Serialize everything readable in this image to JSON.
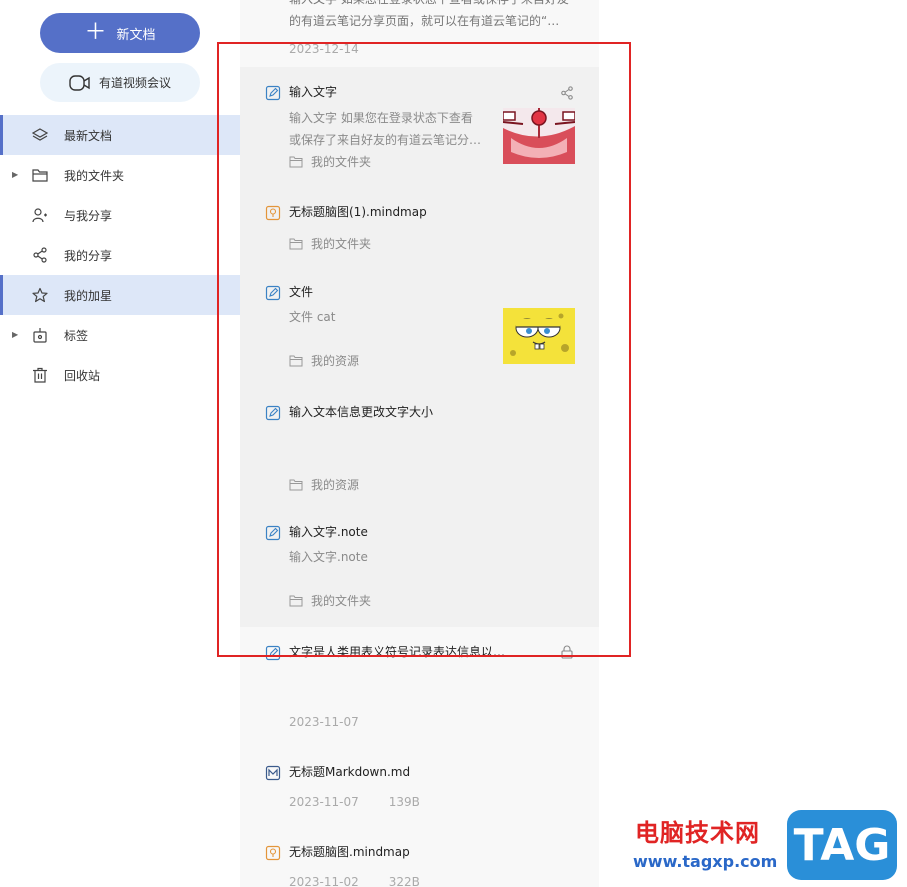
{
  "sidebar": {
    "new_doc": "新文档",
    "video_meeting": "有道视频会议",
    "items": [
      {
        "label": "最新文档",
        "active": true,
        "icon": "layers-icon"
      },
      {
        "label": "我的文件夹",
        "active": false,
        "icon": "folder-icon",
        "expandable": true
      },
      {
        "label": "与我分享",
        "active": false,
        "icon": "users-icon"
      },
      {
        "label": "我的分享",
        "active": false,
        "icon": "share-icon"
      },
      {
        "label": "我的加星",
        "active": true,
        "icon": "star-icon"
      },
      {
        "label": "标签",
        "active": false,
        "icon": "tag-icon",
        "expandable": true
      },
      {
        "label": "回收站",
        "active": false,
        "icon": "trash-icon"
      }
    ]
  },
  "list": {
    "top_partial": {
      "line1": "输入文字 如果您在登录状态下查看或保存了来自好友",
      "line2": "的有道云笔记分享页面，就可以在有道云笔记的“…",
      "date": "2023-12-14"
    },
    "docs": [
      {
        "title": "输入文字",
        "desc1": "输入文字 如果您在登录状态下查看",
        "desc2": "或保存了来自好友的有道云笔记分…",
        "folder": "我的文件夹"
      },
      {
        "title": "无标题脑图(1).mindmap",
        "folder": "我的文件夹"
      },
      {
        "title": "文件",
        "desc1": "文件 cat",
        "folder": "我的资源"
      },
      {
        "title": "输入文本信息更改文字大小",
        "folder": "我的资源"
      },
      {
        "title": "输入文字.note",
        "desc1": "输入文字.note",
        "folder": "我的文件夹"
      },
      {
        "title": "文字是人类用表义符号记录表达信息以…",
        "date": "2023-11-07"
      },
      {
        "title": "无标题Markdown.md",
        "date": "2023-11-07",
        "size": "139B"
      },
      {
        "title": "无标题脑图.mindmap",
        "date": "2023-11-02",
        "size": "322B"
      }
    ]
  },
  "watermark": {
    "cn": "电脑技术网",
    "url": "www.tagxp.com",
    "tag": "TAG"
  },
  "colors": {
    "primary": "#5570c8",
    "annotation": "#e02424"
  }
}
